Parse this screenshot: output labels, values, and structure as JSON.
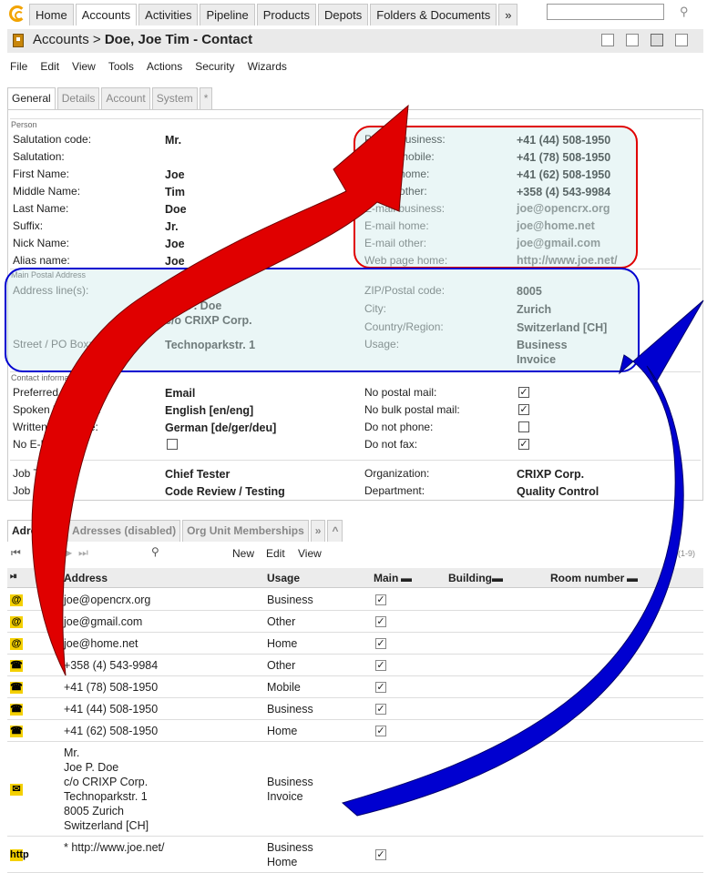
{
  "nav": {
    "tabs": [
      "Home",
      "Accounts",
      "Activities",
      "Pipeline",
      "Products",
      "Depots",
      "Folders & Documents",
      "»"
    ],
    "active": "Accounts",
    "search_value": ""
  },
  "titlebar": {
    "section": "Accounts",
    "separator": ">",
    "object": "Doe, Joe Tim - Contact"
  },
  "menu": [
    "File",
    "Edit",
    "View",
    "Tools",
    "Actions",
    "Security",
    "Wizards"
  ],
  "subtabs": [
    "General",
    "Details",
    "Account",
    "System",
    "*"
  ],
  "person": {
    "section_label": "Person",
    "fields": [
      {
        "label": "Salutation code:",
        "value": "Mr."
      },
      {
        "label": "Salutation:",
        "value": ""
      },
      {
        "label": "First Name:",
        "value": "Joe"
      },
      {
        "label": "Middle Name:",
        "value": "Tim"
      },
      {
        "label": "Last Name:",
        "value": "Doe"
      },
      {
        "label": "Suffix:",
        "value": "Jr."
      },
      {
        "label": "Nick Name:",
        "value": "Joe"
      },
      {
        "label": "Alias name:",
        "value": "Joe"
      }
    ],
    "contact": [
      {
        "label": "Phone business:",
        "value": "+41 (44) 508-1950"
      },
      {
        "label": "Phone mobile:",
        "value": "+41 (78) 508-1950"
      },
      {
        "label": "Phone home:",
        "value": "+41 (62) 508-1950"
      },
      {
        "label": "Phone other:",
        "value": "+358 (4) 543-9984"
      },
      {
        "label": "E-mail business:",
        "value": "joe@opencrx.org"
      },
      {
        "label": "E-mail home:",
        "value": "joe@home.net"
      },
      {
        "label": "E-mail other:",
        "value": "joe@gmail.com"
      },
      {
        "label": "Web page home:",
        "value": "http://www.joe.net/"
      }
    ]
  },
  "postal": {
    "section_label": "Main Postal Address",
    "address_label": "Address line(s):",
    "address_lines": [
      "Mr.",
      "Joe P. Doe",
      "c/o CRIXP Corp."
    ],
    "street_label": "Street / PO Box:",
    "street": "Technoparkstr. 1",
    "zip_label": "ZIP/Postal code:",
    "zip": "8005",
    "city_label": "City:",
    "city": "Zurich",
    "country_label": "Country/Region:",
    "country": "Switzerland [CH]",
    "usage_label": "Usage:",
    "usage": [
      "Business",
      "Invoice"
    ]
  },
  "contactinfo": {
    "section_label": "Contact information",
    "preferred_label": "Preferred method:",
    "preferred": "Email",
    "spoken_label": "Spoken language:",
    "spoken": "English [en/eng]",
    "written_label": "Written language:",
    "written": "German [de/ger/deu]",
    "noemail_label": "No E-Mail:",
    "flags": [
      {
        "label": "No postal mail:",
        "checked": true
      },
      {
        "label": "No bulk postal mail:",
        "checked": true
      },
      {
        "label": "Do not phone:",
        "checked": false
      },
      {
        "label": "Do not fax:",
        "checked": true
      }
    ]
  },
  "job": {
    "title_label": "Job Title:",
    "title": "Chief Tester",
    "role_label": "Job Role:",
    "role": "Code Review / Testing",
    "org_label": "Organization:",
    "org": "CRIXP Corp.",
    "dept_label": "Department:",
    "dept": "Quality Control"
  },
  "grid_tabs": [
    "Adresses",
    "Adresses (disabled)",
    "Org Unit Memberships",
    "»",
    "^"
  ],
  "grid_toolbar": {
    "new": "New",
    "edit": "Edit",
    "view": "View",
    "count": "(1-9)"
  },
  "grid_columns": [
    "Address",
    "Usage",
    "Main",
    "Building",
    "Room number"
  ],
  "grid_rows": [
    {
      "icon": "@",
      "address": [
        "joe@opencrx.org"
      ],
      "usage": [
        "Business"
      ],
      "main": true
    },
    {
      "icon": "@",
      "address": [
        "joe@gmail.com"
      ],
      "usage": [
        "Other"
      ],
      "main": true
    },
    {
      "icon": "@",
      "address": [
        "joe@home.net"
      ],
      "usage": [
        "Home"
      ],
      "main": true
    },
    {
      "icon": "☎",
      "address": [
        "+358 (4) 543-9984"
      ],
      "usage": [
        "Other"
      ],
      "main": true
    },
    {
      "icon": "☎",
      "address": [
        "+41 (78) 508-1950"
      ],
      "usage": [
        "Mobile"
      ],
      "main": true
    },
    {
      "icon": "☎",
      "address": [
        "+41 (44) 508-1950"
      ],
      "usage": [
        "Business"
      ],
      "main": true
    },
    {
      "icon": "☎",
      "address": [
        "+41 (62) 508-1950"
      ],
      "usage": [
        "Home"
      ],
      "main": true
    },
    {
      "icon": "✉",
      "address": [
        "Mr.",
        "Joe P. Doe",
        "c/o CRIXP Corp.",
        "Technoparkstr. 1",
        "8005 Zurich",
        "Switzerland [CH]"
      ],
      "usage": [
        "Business",
        "Invoice"
      ],
      "main": false
    },
    {
      "icon": "http",
      "address": [
        "* http://www.joe.net/"
      ],
      "usage": [
        "Business",
        "Home"
      ],
      "main": true
    }
  ],
  "colors": {
    "red_arrow": "#e00000",
    "blue_arrow": "#0000d0",
    "highlight": "#c4e6e6"
  }
}
